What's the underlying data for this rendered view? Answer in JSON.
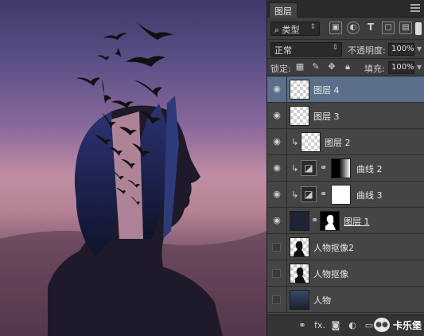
{
  "panel": {
    "title": "图层",
    "filter_kind": "类型",
    "blend_mode": "正常",
    "opacity_label": "不透明度:",
    "opacity_value": "100%",
    "lock_label": "锁定:",
    "fill_label": "填充:",
    "fill_value": "100%"
  },
  "layers": [
    {
      "name": "图层 4",
      "visible": true,
      "selected": true
    },
    {
      "name": "图层 3",
      "visible": true
    },
    {
      "name": "图层 2",
      "visible": true
    },
    {
      "name": "曲线 2",
      "visible": true
    },
    {
      "name": "曲线 3",
      "visible": true
    },
    {
      "name": "图层 1",
      "visible": true
    },
    {
      "name": "人物抠像2",
      "visible": false
    },
    {
      "name": "人物抠像",
      "visible": false
    },
    {
      "name": "人物",
      "visible": false
    }
  ],
  "bottom": {
    "fx_label": "fx.",
    "brand_text": "卡乐堡"
  },
  "colors": {
    "selected_row": "#5b6f8c",
    "panel_bg": "#3d3d3d"
  }
}
